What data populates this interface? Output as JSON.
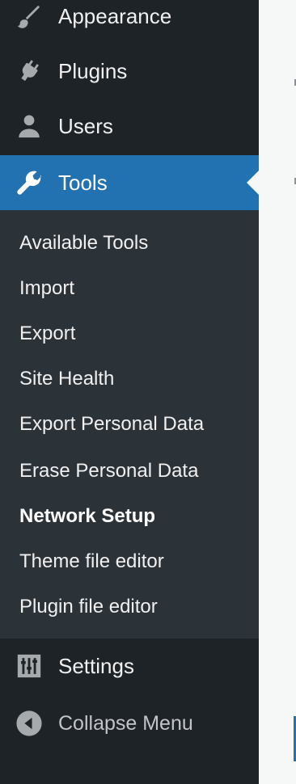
{
  "colors": {
    "menu_bg": "#1d2327",
    "submenu_bg": "#2c3338",
    "active_bg": "#2271b1",
    "text": "#f0f0f1",
    "icon": "#a7aaad"
  },
  "menu": {
    "items": [
      {
        "label": "Appearance",
        "icon": "paintbrush-icon"
      },
      {
        "label": "Plugins",
        "icon": "plug-icon"
      },
      {
        "label": "Users",
        "icon": "user-icon"
      },
      {
        "label": "Tools",
        "icon": "wrench-icon",
        "active": true
      },
      {
        "label": "Settings",
        "icon": "sliders-icon"
      }
    ],
    "tools_submenu": [
      {
        "label": "Available Tools"
      },
      {
        "label": "Import"
      },
      {
        "label": "Export"
      },
      {
        "label": "Site Health"
      },
      {
        "label": "Export Personal Data"
      },
      {
        "label": "Erase Personal Data"
      },
      {
        "label": "Network Setup",
        "current": true
      },
      {
        "label": "Theme file editor"
      },
      {
        "label": "Plugin file editor"
      }
    ],
    "collapse": {
      "label": "Collapse Menu",
      "icon": "collapse-left-icon"
    }
  }
}
